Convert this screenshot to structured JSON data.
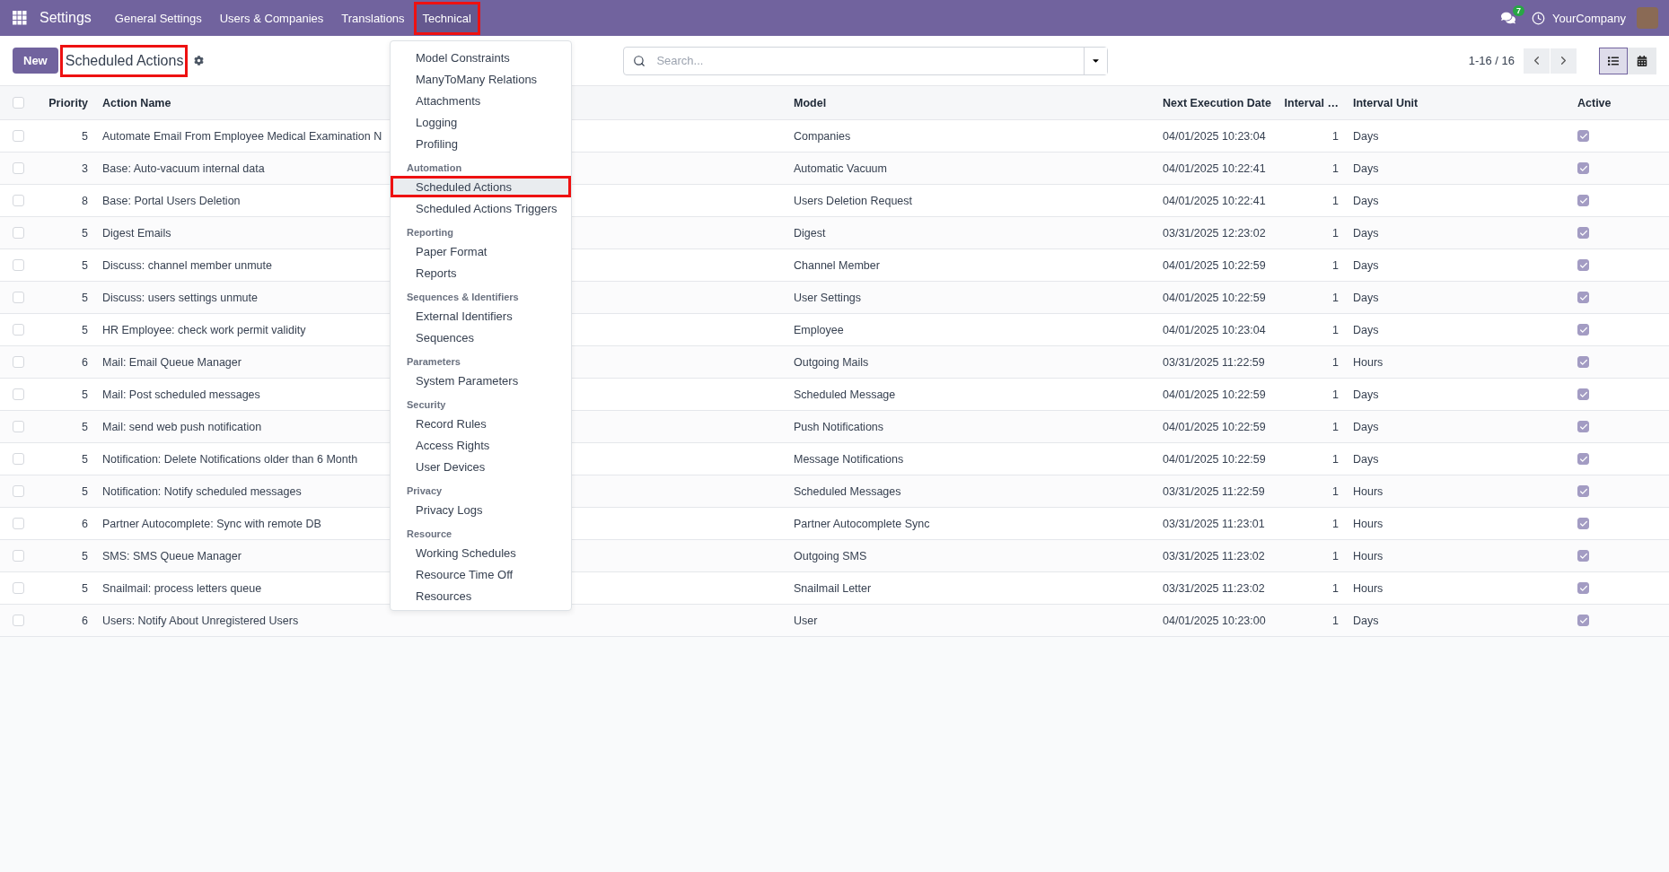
{
  "navbar": {
    "app_name": "Settings",
    "menu": [
      {
        "label": "General Settings",
        "highlighted": false
      },
      {
        "label": "Users & Companies",
        "highlighted": false
      },
      {
        "label": "Translations",
        "highlighted": false
      },
      {
        "label": "Technical",
        "highlighted": true
      }
    ],
    "messages_badge": "7",
    "company": "YourCompany"
  },
  "control_panel": {
    "new_button": "New",
    "title": {
      "text": "Scheduled Actions",
      "highlighted": true
    },
    "search": {
      "placeholder": "Search..."
    },
    "pager": "1-16 / 16",
    "views": [
      {
        "kind": "list",
        "selected": true
      },
      {
        "kind": "calendar",
        "selected": false
      }
    ]
  },
  "table": {
    "select_all_checked": false,
    "columns": [
      "Priority",
      "Action Name",
      "Model",
      "Next Execution Date",
      "Interval …",
      "Interval Unit",
      "Active"
    ],
    "rows": [
      {
        "selected": false,
        "priority": "5",
        "action_name": "Automate Email From Employee Medical Examination N",
        "model": "Companies",
        "next_execution": "04/01/2025 10:23:04",
        "interval_number": "1",
        "interval_unit": "Days",
        "active": true
      },
      {
        "selected": false,
        "priority": "3",
        "action_name": "Base: Auto-vacuum internal data",
        "model": "Automatic Vacuum",
        "next_execution": "04/01/2025 10:22:41",
        "interval_number": "1",
        "interval_unit": "Days",
        "active": true
      },
      {
        "selected": false,
        "priority": "8",
        "action_name": "Base: Portal Users Deletion",
        "model": "Users Deletion Request",
        "next_execution": "04/01/2025 10:22:41",
        "interval_number": "1",
        "interval_unit": "Days",
        "active": true
      },
      {
        "selected": false,
        "priority": "5",
        "action_name": "Digest Emails",
        "model": "Digest",
        "next_execution": "03/31/2025 12:23:02",
        "interval_number": "1",
        "interval_unit": "Days",
        "active": true
      },
      {
        "selected": false,
        "priority": "5",
        "action_name": "Discuss: channel member unmute",
        "model": "Channel Member",
        "next_execution": "04/01/2025 10:22:59",
        "interval_number": "1",
        "interval_unit": "Days",
        "active": true
      },
      {
        "selected": false,
        "priority": "5",
        "action_name": "Discuss: users settings unmute",
        "model": "User Settings",
        "next_execution": "04/01/2025 10:22:59",
        "interval_number": "1",
        "interval_unit": "Days",
        "active": true
      },
      {
        "selected": false,
        "priority": "5",
        "action_name": "HR Employee: check work permit validity",
        "model": "Employee",
        "next_execution": "04/01/2025 10:23:04",
        "interval_number": "1",
        "interval_unit": "Days",
        "active": true
      },
      {
        "selected": false,
        "priority": "6",
        "action_name": "Mail: Email Queue Manager",
        "model": "Outgoing Mails",
        "next_execution": "03/31/2025 11:22:59",
        "interval_number": "1",
        "interval_unit": "Hours",
        "active": true
      },
      {
        "selected": false,
        "priority": "5",
        "action_name": "Mail: Post scheduled messages",
        "model": "Scheduled Message",
        "next_execution": "04/01/2025 10:22:59",
        "interval_number": "1",
        "interval_unit": "Days",
        "active": true
      },
      {
        "selected": false,
        "priority": "5",
        "action_name": "Mail: send web push notification",
        "model": "Push Notifications",
        "next_execution": "04/01/2025 10:22:59",
        "interval_number": "1",
        "interval_unit": "Days",
        "active": true
      },
      {
        "selected": false,
        "priority": "5",
        "action_name": "Notification: Delete Notifications older than 6 Month",
        "model": "Message Notifications",
        "next_execution": "04/01/2025 10:22:59",
        "interval_number": "1",
        "interval_unit": "Days",
        "active": true
      },
      {
        "selected": false,
        "priority": "5",
        "action_name": "Notification: Notify scheduled messages",
        "model": "Scheduled Messages",
        "next_execution": "03/31/2025 11:22:59",
        "interval_number": "1",
        "interval_unit": "Hours",
        "active": true
      },
      {
        "selected": false,
        "priority": "6",
        "action_name": "Partner Autocomplete: Sync with remote DB",
        "model": "Partner Autocomplete Sync",
        "next_execution": "03/31/2025 11:23:01",
        "interval_number": "1",
        "interval_unit": "Hours",
        "active": true
      },
      {
        "selected": false,
        "priority": "5",
        "action_name": "SMS: SMS Queue Manager",
        "model": "Outgoing SMS",
        "next_execution": "03/31/2025 11:23:02",
        "interval_number": "1",
        "interval_unit": "Hours",
        "active": true
      },
      {
        "selected": false,
        "priority": "5",
        "action_name": "Snailmail: process letters queue",
        "model": "Snailmail Letter",
        "next_execution": "03/31/2025 11:23:02",
        "interval_number": "1",
        "interval_unit": "Hours",
        "active": true
      },
      {
        "selected": false,
        "priority": "6",
        "action_name": "Users: Notify About Unregistered Users",
        "model": "User",
        "next_execution": "04/01/2025 10:23:00",
        "interval_number": "1",
        "interval_unit": "Days",
        "active": true
      }
    ]
  },
  "dropdown": {
    "sections": [
      {
        "items": [
          {
            "label": "Model Constraints",
            "selected": false,
            "highlighted": false
          },
          {
            "label": "ManyToMany Relations",
            "selected": false,
            "highlighted": false
          },
          {
            "label": "Attachments",
            "selected": false,
            "highlighted": false
          },
          {
            "label": "Logging",
            "selected": false,
            "highlighted": false
          },
          {
            "label": "Profiling",
            "selected": false,
            "highlighted": false
          }
        ]
      },
      {
        "heading": "Automation",
        "items": [
          {
            "label": "Scheduled Actions",
            "selected": true,
            "highlighted": true
          },
          {
            "label": "Scheduled Actions Triggers",
            "selected": false,
            "highlighted": false
          }
        ]
      },
      {
        "heading": "Reporting",
        "items": [
          {
            "label": "Paper Format",
            "selected": false,
            "highlighted": false
          },
          {
            "label": "Reports",
            "selected": false,
            "highlighted": false
          }
        ]
      },
      {
        "heading": "Sequences & Identifiers",
        "items": [
          {
            "label": "External Identifiers",
            "selected": false,
            "highlighted": false
          },
          {
            "label": "Sequences",
            "selected": false,
            "highlighted": false
          }
        ]
      },
      {
        "heading": "Parameters",
        "items": [
          {
            "label": "System Parameters",
            "selected": false,
            "highlighted": false
          }
        ]
      },
      {
        "heading": "Security",
        "items": [
          {
            "label": "Record Rules",
            "selected": false,
            "highlighted": false
          },
          {
            "label": "Access Rights",
            "selected": false,
            "highlighted": false
          },
          {
            "label": "User Devices",
            "selected": false,
            "highlighted": false
          }
        ]
      },
      {
        "heading": "Privacy",
        "items": [
          {
            "label": "Privacy Logs",
            "selected": false,
            "highlighted": false
          }
        ]
      },
      {
        "heading": "Resource",
        "items": [
          {
            "label": "Working Schedules",
            "selected": false,
            "highlighted": false
          },
          {
            "label": "Resource Time Off",
            "selected": false,
            "highlighted": false
          },
          {
            "label": "Resources",
            "selected": false,
            "highlighted": false
          }
        ]
      }
    ]
  }
}
